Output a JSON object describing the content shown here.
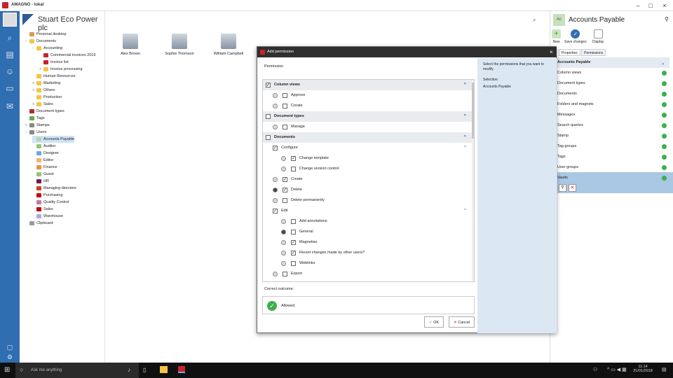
{
  "window": {
    "title": "AMAGNO - lokal"
  },
  "company": {
    "name": "Stuart Eco Power plc"
  },
  "tree": [
    {
      "label": "Personal desktop",
      "lvl": 0,
      "c": "#d99a4e"
    },
    {
      "label": "Documents",
      "lvl": 0,
      "c": "#f4c542",
      "exp": "−"
    },
    {
      "label": "Accounting",
      "lvl": 1,
      "c": "#f4c542",
      "exp": "−"
    },
    {
      "label": "Commercial invoices 2015",
      "lvl": 2,
      "c": "#c8232c"
    },
    {
      "label": "Invoice list",
      "lvl": 2,
      "c": "#c8232c"
    },
    {
      "label": "Invoice processing",
      "lvl": 2,
      "c": "#f4c542",
      "exp": "+"
    },
    {
      "label": "Human Resources",
      "lvl": 1,
      "c": "#f4c542"
    },
    {
      "label": "Marketing",
      "lvl": 1,
      "c": "#f4c542",
      "exp": "+"
    },
    {
      "label": "Others",
      "lvl": 1,
      "c": "#f4c542",
      "exp": "+"
    },
    {
      "label": "Production",
      "lvl": 1,
      "c": "#f4c542"
    },
    {
      "label": "Sales",
      "lvl": 1,
      "c": "#f4c542",
      "exp": "+"
    },
    {
      "label": "Document types",
      "lvl": 0,
      "c": "#b02a2a"
    },
    {
      "label": "Tags",
      "lvl": 0,
      "c": "#6aa84f"
    },
    {
      "label": "Stamps",
      "lvl": 0,
      "c": "#888",
      "exp": "+"
    },
    {
      "label": "Users",
      "lvl": 0,
      "c": "#888",
      "exp": "−"
    },
    {
      "label": "Accounts Payable",
      "lvl": 1,
      "c": "#b6d7a8",
      "sel": true
    },
    {
      "label": "Auditor",
      "lvl": 1,
      "c": "#93c47d"
    },
    {
      "label": "Designer",
      "lvl": 1,
      "c": "#6fa8dc"
    },
    {
      "label": "Editor",
      "lvl": 1,
      "c": "#f6b26b"
    },
    {
      "label": "Finance",
      "lvl": 1,
      "c": "#e69138"
    },
    {
      "label": "Guest",
      "lvl": 1,
      "c": "#93c47d"
    },
    {
      "label": "HR",
      "lvl": 1,
      "c": "#741b47"
    },
    {
      "label": "Managing directors",
      "lvl": 1,
      "c": "#cc4125"
    },
    {
      "label": "Purchasing",
      "lvl": 1,
      "c": "#cc0000"
    },
    {
      "label": "Quality Control",
      "lvl": 1,
      "c": "#c27ba0"
    },
    {
      "label": "Sales",
      "lvl": 1,
      "c": "#c00000"
    },
    {
      "label": "Warehouse",
      "lvl": 1,
      "c": "#b4a7d6"
    },
    {
      "label": "Clipboard",
      "lvl": 0,
      "c": "#999"
    }
  ],
  "users": [
    {
      "name": "Alex Brown"
    },
    {
      "name": "Sophie Thomson"
    },
    {
      "name": "William Campbell"
    }
  ],
  "right": {
    "title": "Accounts Payable",
    "icon_text": "Ac",
    "new": "New",
    "save": "Save changes",
    "display": "Display",
    "tab_props": "Properties",
    "tab_perms": "Permissions",
    "perms": [
      "Accounts Payable",
      "Column views",
      "Document types",
      "Documents",
      "Folders and magnets",
      "Messages",
      "Search queries",
      "Stamp",
      "Tag groups",
      "Tags",
      "User groups",
      "Vaults"
    ]
  },
  "dialog": {
    "title": "Add permission",
    "section": "Permission",
    "hint": "Select the permissions that you want to modify.",
    "sel_label": "Selection:",
    "sel_value": "Accounts Payable",
    "outcome_label": "Correct outcome:",
    "outcome_value": "Allowed",
    "ok": "OK",
    "cancel": "Cancel",
    "rows": [
      {
        "t": "Column views",
        "h": true,
        "cb": true,
        "ind": 0
      },
      {
        "t": "Approve",
        "ind": 1,
        "r": 0,
        "cb": false
      },
      {
        "t": "Create",
        "ind": 1,
        "r": 0,
        "cb": false
      },
      {
        "t": "Document types",
        "h": true,
        "cb": false,
        "ind": 0
      },
      {
        "t": "Manage",
        "ind": 1,
        "r": 0,
        "cb": false
      },
      {
        "t": "Documents",
        "h": true,
        "cb": false,
        "ind": 0
      },
      {
        "t": "Configure",
        "ind": 1,
        "cb": true,
        "chev": true
      },
      {
        "t": "Change template",
        "ind": 2,
        "r": 0,
        "cb": true
      },
      {
        "t": "Change version control",
        "ind": 2,
        "r": 0,
        "cb": false
      },
      {
        "t": "Create",
        "ind": 1,
        "r": 0,
        "cb": true
      },
      {
        "t": "Delete",
        "ind": 1,
        "r": 1,
        "cb": true
      },
      {
        "t": "Delete permanently",
        "ind": 1,
        "r": 0,
        "cb": false
      },
      {
        "t": "Edit",
        "ind": 1,
        "cb": true,
        "chev": true
      },
      {
        "t": "Add annotations",
        "ind": 2,
        "r": 0,
        "cb": false
      },
      {
        "t": "General",
        "ind": 2,
        "r": 1,
        "cb": false
      },
      {
        "t": "Magnetise",
        "ind": 2,
        "r": 0,
        "cb": true
      },
      {
        "t": "Revert changes made by other users?",
        "ind": 2,
        "r": 0,
        "cb": true
      },
      {
        "t": "Weblinks",
        "ind": 2,
        "r": 0,
        "cb": false
      },
      {
        "t": "Export",
        "ind": 1,
        "r": 0,
        "cb": false
      }
    ]
  },
  "taskbar": {
    "search": "Ask me anything",
    "time": "11:14",
    "date": "31/01/2018"
  }
}
